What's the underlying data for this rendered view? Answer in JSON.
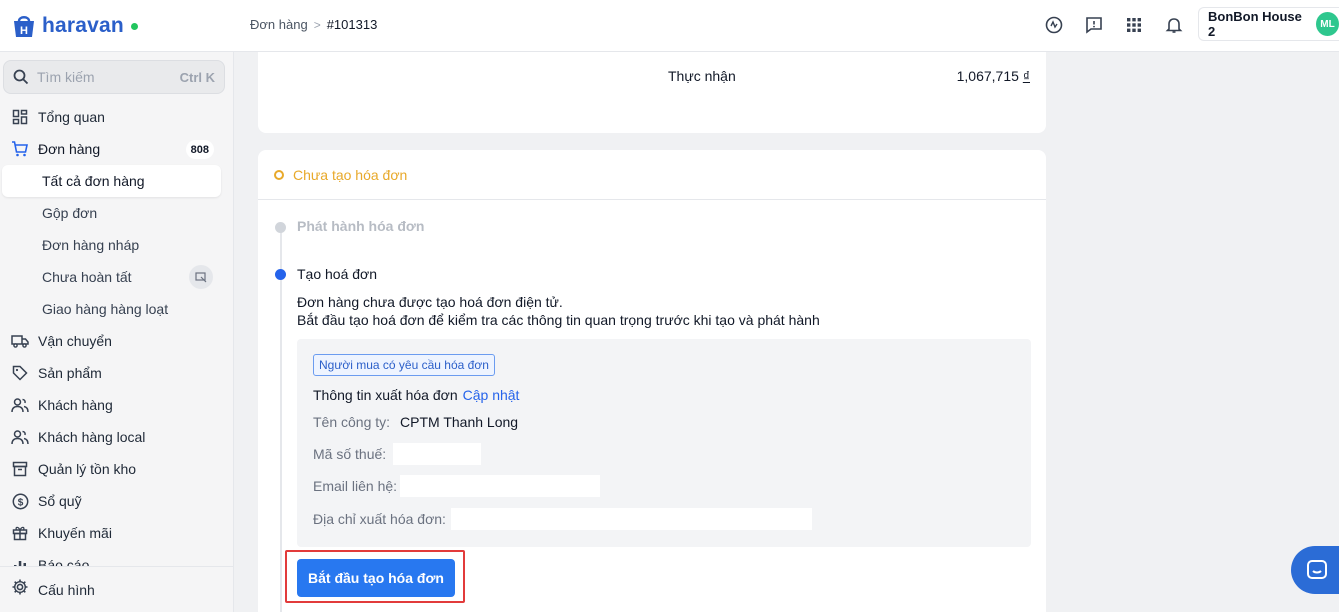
{
  "app": {
    "logo_text": "haravan",
    "brand_color": "#2b5fc9"
  },
  "breadcrumb": {
    "parent": "Đơn hàng",
    "separator": ">",
    "current": "#101313"
  },
  "topbar": {
    "icons": [
      "headset-icon",
      "feedback-icon",
      "apps-grid-icon",
      "bell-icon"
    ],
    "store_name": "BonBon House 2",
    "avatar_initials": "ML"
  },
  "sidebar": {
    "search_placeholder": "Tìm kiếm",
    "search_shortcut": "Ctrl K",
    "items": [
      {
        "label": "Tổng quan",
        "icon": "dashboard-icon"
      },
      {
        "label": "Đơn hàng",
        "icon": "cart-icon",
        "badge": "808"
      },
      {
        "label": "Vận chuyển",
        "icon": "truck-icon"
      },
      {
        "label": "Sản phẩm",
        "icon": "tag-icon"
      },
      {
        "label": "Khách hàng",
        "icon": "users-icon"
      },
      {
        "label": "Khách hàng local",
        "icon": "users-local-icon"
      },
      {
        "label": "Quản lý tồn kho",
        "icon": "inventory-icon"
      },
      {
        "label": "Sổ quỹ",
        "icon": "cashbook-icon"
      },
      {
        "label": "Khuyến mãi",
        "icon": "gift-icon"
      },
      {
        "label": "Báo cáo",
        "icon": "report-icon"
      }
    ],
    "subitems": [
      {
        "label": "Tất cả đơn hàng",
        "active": true
      },
      {
        "label": "Gộp đơn"
      },
      {
        "label": "Đơn hàng nháp"
      },
      {
        "label": "Chưa hoàn tất"
      },
      {
        "label": "Giao hàng hàng loạt"
      }
    ],
    "settings_label": "Cấu hình"
  },
  "summary": {
    "net_label": "Thực nhận",
    "net_value": "1,067,715",
    "currency": "₫"
  },
  "invoice": {
    "status": "Chưa tạo hóa đơn",
    "status_color": "#e8a92a",
    "step_issue": "Phát hành hóa đơn",
    "step_create": "Tạo hoá đơn",
    "desc_line1": "Đơn hàng chưa được tạo hoá đơn điện tử.",
    "desc_line2": "Bắt đầu tạo hoá đơn để kiểm tra các thông tin quan trọng trước khi tạo và phát hành",
    "buyer_tag": "Người mua có yêu cầu hóa đơn",
    "info_title": "Thông tin xuất hóa đơn",
    "update_link": "Cập nhật",
    "company_label": "Tên công ty:",
    "company_value": "CPTM Thanh Long",
    "tax_label": "Mã số thuế:",
    "email_label": "Email liên hệ:",
    "address_label": "Địa chỉ xuất hóa đơn:",
    "cta_label": "Bắt đầu tạo hóa đơn",
    "cta_color": "#2878f0"
  }
}
